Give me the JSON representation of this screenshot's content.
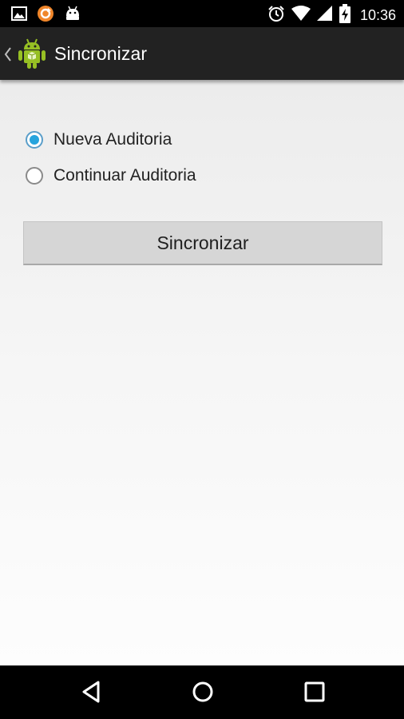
{
  "status_bar": {
    "time": "10:36",
    "left_icons": [
      "image-icon",
      "sync-app-icon",
      "android-icon"
    ],
    "right_icons": [
      "alarm-icon",
      "wifi-icon",
      "cellular-icon",
      "battery-charging-icon"
    ]
  },
  "action_bar": {
    "title": "Sincronizar",
    "up_icon": "chevron-left-icon",
    "app_icon": "android-app-icon"
  },
  "form": {
    "radio_options": [
      {
        "label": "Nueva Auditoria",
        "checked": true
      },
      {
        "label": "Continuar Auditoria",
        "checked": false
      }
    ],
    "submit_label": "Sincronizar"
  },
  "nav_bar": {
    "icons": [
      "back-icon",
      "home-icon",
      "recents-icon"
    ]
  },
  "colors": {
    "radio_accent": "#27a4dd",
    "action_bar": "#222222",
    "android_green": "#97c024"
  }
}
